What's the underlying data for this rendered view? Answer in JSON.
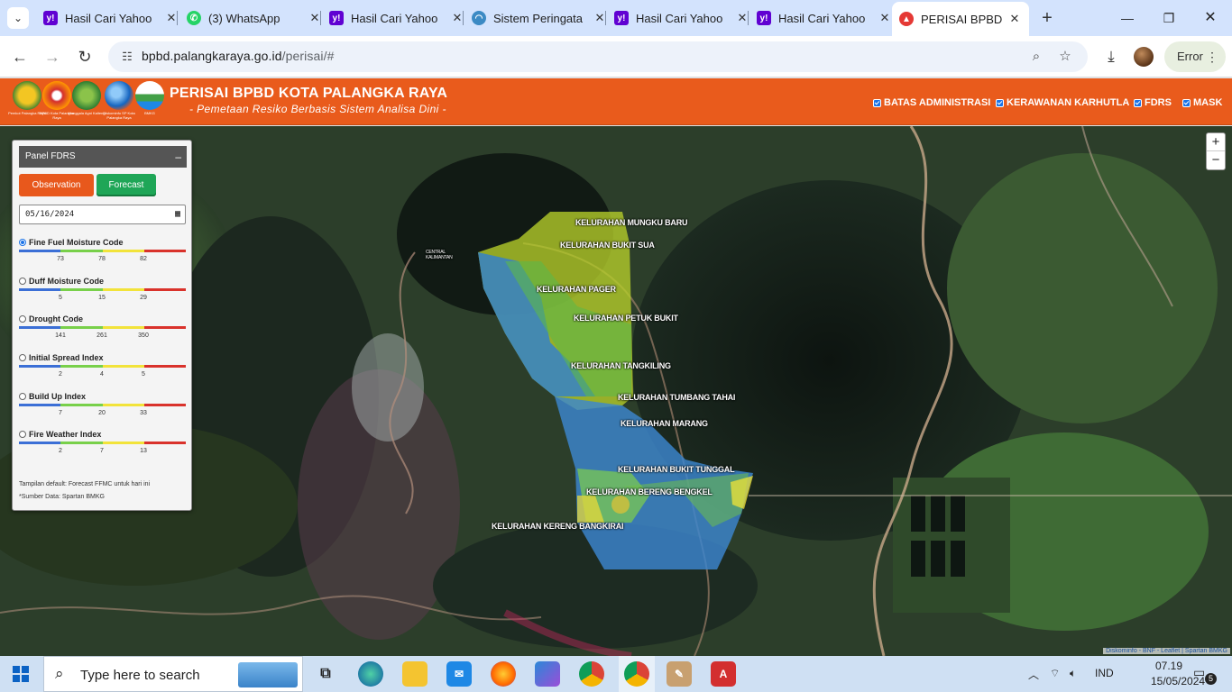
{
  "browser": {
    "tabs": [
      {
        "label": "Hasil Cari Yahoo",
        "icon": "yahoo-icon",
        "color": "#6001d2"
      },
      {
        "label": "(3) WhatsApp",
        "icon": "whatsapp-icon",
        "color": "#25d366"
      },
      {
        "label": "Hasil Cari Yahoo",
        "icon": "yahoo-icon",
        "color": "#6001d2"
      },
      {
        "label": "Sistem Peringata",
        "icon": "bmkg-icon",
        "color": "#3b8ac4"
      },
      {
        "label": "Hasil Cari Yahoo",
        "icon": "yahoo-icon",
        "color": "#6001d2"
      },
      {
        "label": "Hasil Cari Yahoo",
        "icon": "yahoo-icon",
        "color": "#6001d2"
      },
      {
        "label": "PERISAI BPBD Ko",
        "icon": "perisai-icon",
        "color": "#e53935",
        "active": true
      }
    ],
    "url_host": "bpbd.palangkaraya.go.id",
    "url_path": "/perisai/#",
    "error_label": "Error"
  },
  "header": {
    "title": "PERISAI BPBD KOTA PALANGKA RAYA",
    "subtitle": "- Pemetaan Resiko Berbasis Sistem Analisa Dini -",
    "logos": [
      {
        "name": "pemkot-logo",
        "caption": "Pemkot Palangka Raya",
        "color": "#f3c623"
      },
      {
        "name": "bpbd-logo",
        "caption": "BPBD Kota Palangka Raya",
        "color": "#d32f2f"
      },
      {
        "name": "manggala-agni-logo",
        "caption": "Manggala Agni Kalteng",
        "color": "#2e7d32"
      },
      {
        "name": "diskominfo-logo",
        "caption": "Diskominfo SP Kota Palangka Raya",
        "color": "#1565c0"
      },
      {
        "name": "bmkg-logo",
        "caption": "BMKG",
        "color": "#43a047"
      }
    ],
    "layers": [
      {
        "label": "BATAS ADMINISTRASI",
        "checked": true
      },
      {
        "label": "KERAWANAN KARHUTLA",
        "checked": true
      },
      {
        "label": "FDRS",
        "checked": true
      },
      {
        "label": "MASK",
        "checked": true
      }
    ]
  },
  "panel": {
    "title": "Panel FDRS",
    "minimize": "–",
    "observation_label": "Observation",
    "forecast_label": "Forecast",
    "date_value": "05/16/2024",
    "indices": [
      {
        "label": "Fine Fuel Moisture Code",
        "selected": true,
        "ticks": [
          "73",
          "78",
          "82"
        ]
      },
      {
        "label": "Duff Moisture Code",
        "selected": false,
        "ticks": [
          "5",
          "15",
          "29"
        ]
      },
      {
        "label": "Drought Code",
        "selected": false,
        "ticks": [
          "141",
          "261",
          "350"
        ]
      },
      {
        "label": "Initial Spread Index",
        "selected": false,
        "ticks": [
          "2",
          "4",
          "5"
        ]
      },
      {
        "label": "Build Up Index",
        "selected": false,
        "ticks": [
          "7",
          "20",
          "33"
        ]
      },
      {
        "label": "Fire Weather Index",
        "selected": false,
        "ticks": [
          "2",
          "7",
          "13"
        ]
      }
    ],
    "scale_colors": [
      "#3b6fd6",
      "#78d04a",
      "#f2e33a",
      "#d9322b"
    ],
    "note_default": "Tampilan default: Forecast FFMC untuk hari ini",
    "note_source": "*Sumber Data: Spartan BMKG"
  },
  "map": {
    "zoom_in": "+",
    "zoom_out": "−",
    "kelurahan": [
      "KELURAHAN MUNGKU BARU",
      "KELURAHAN BUKIT SUA",
      "KELURAHAN PAGER",
      "KELURAHAN PETUK BUKIT",
      "KELURAHAN TANGKILING",
      "KELURAHAN TUMBANG TAHAI",
      "KELURAHAN MARANG",
      "KELURAHAN BUKIT TUNGGAL",
      "KELURAHAN BERENG BENGKEL",
      "KELURAHAN KERENG BANGKIRAI"
    ],
    "place_label": "CENTRAL KALIMANTAN",
    "attribution": "Diskominfo - BNF - Leaflet | Spartan BMKG"
  },
  "taskbar": {
    "search_placeholder": "Type here to search",
    "language": "IND",
    "time": "07.19",
    "date": "15/05/2024",
    "notification_count": "5"
  }
}
